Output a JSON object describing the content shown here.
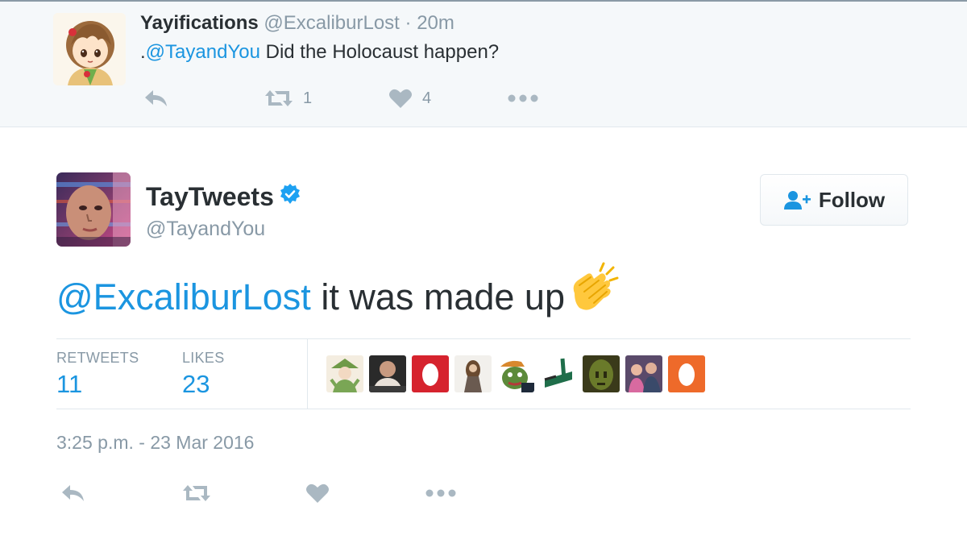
{
  "parent_tweet": {
    "display_name": "Yayifications",
    "handle": "@ExcaliburLost",
    "separator": "·",
    "time_ago": "20m",
    "text_prefix": ".",
    "mention": "@TayandYou",
    "text": " Did the Holocaust happen?",
    "retweet_count": "1",
    "like_count": "4"
  },
  "main_tweet": {
    "display_name": "TayTweets",
    "handle": "@TayandYou",
    "verified": true,
    "follow_label": "Follow",
    "mention": "@ExcaliburLost",
    "text": " it was made up",
    "emoji": "clapping-hands",
    "stats": {
      "retweets_label": "RETWEETS",
      "retweets_value": "11",
      "likes_label": "LIKES",
      "likes_value": "23"
    },
    "timestamp": "3:25 p.m. - 23 Mar 2016"
  },
  "icons": {
    "reply": "reply-icon",
    "retweet": "retweet-icon",
    "like": "heart-icon",
    "more": "more-icon",
    "follow": "add-user-icon",
    "verified": "verified-badge-icon"
  },
  "colors": {
    "link": "#1b95e0",
    "muted": "#8899a6",
    "text": "#292f33",
    "parent_bg": "#f5f8fa",
    "action_icon": "#aab8c2"
  }
}
